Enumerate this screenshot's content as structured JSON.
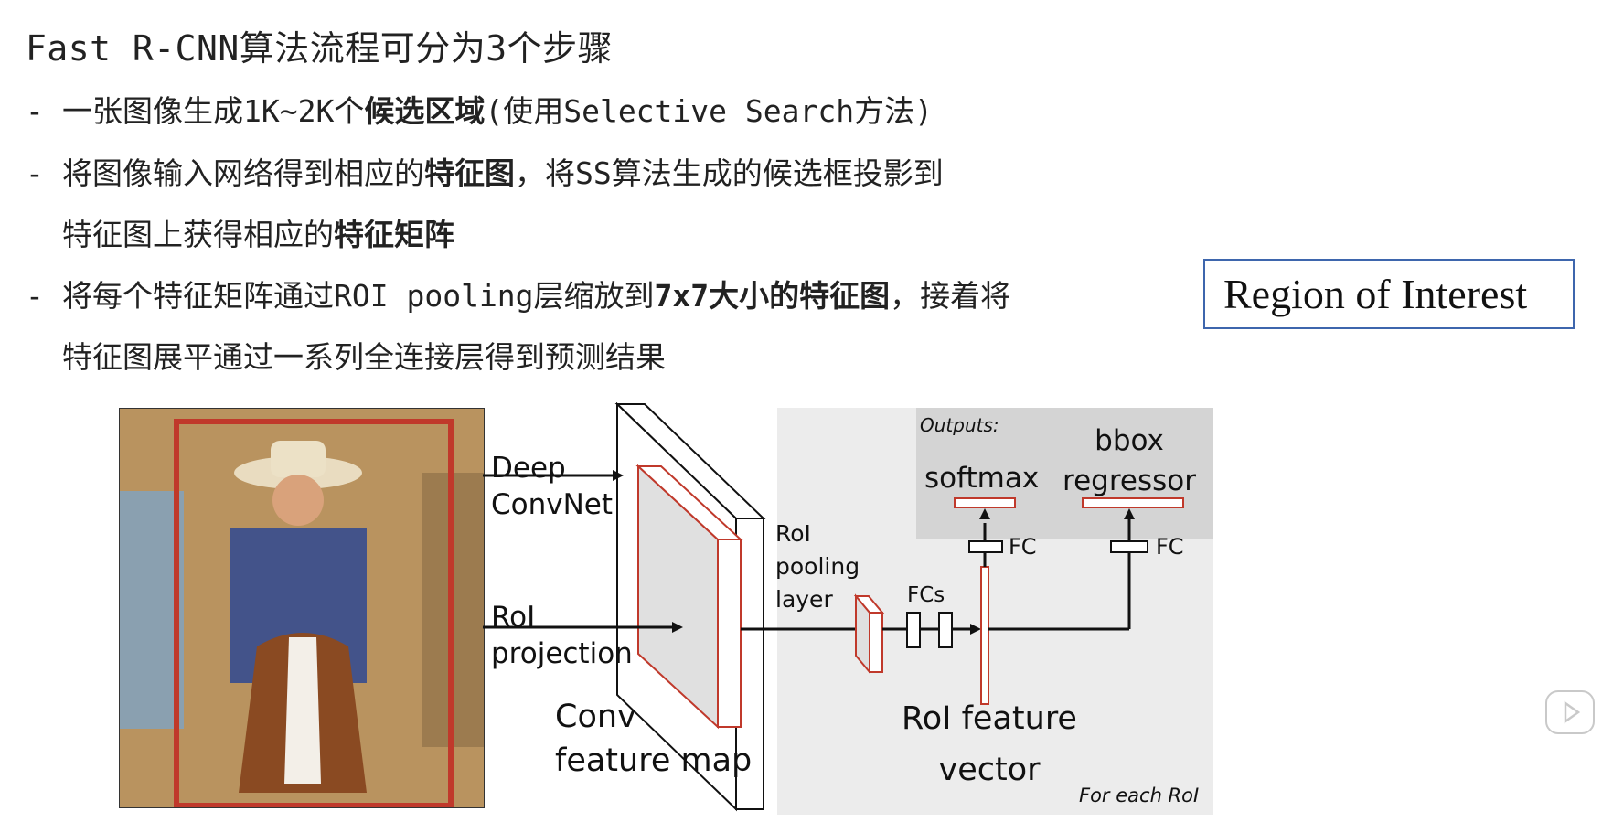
{
  "title": "Fast R-CNN算法流程可分为3个步骤",
  "steps": [
    {
      "dash": "-",
      "plain1": "一张图像生成1K~2K个",
      "bold1": "候选区域",
      "plain2": "(使用Selective Search方法)"
    },
    {
      "dash": "-",
      "plain1": "将图像输入网络得到相应的",
      "bold1": "特征图",
      "plain2": "，将SS算法生成的候选框投影到",
      "cont_plain": "特征图上获得相应的",
      "cont_bold": "特征矩阵"
    },
    {
      "dash": "-",
      "plain1": "将每个特征矩阵通过ROI pooling层缩放到",
      "bold1": "7x7大小的特征图",
      "plain2": "，接着将",
      "cont_plain": "特征图展平通过一系列全连接层得到预测结果"
    }
  ],
  "roi_box": "Region of Interest",
  "diagram": {
    "deep_convnet": [
      "Deep",
      "ConvNet"
    ],
    "roi_projection": [
      "RoI",
      "projection"
    ],
    "conv_feature_map": [
      "Conv",
      "feature map"
    ],
    "roi_pooling_layer": [
      "RoI",
      "pooling",
      "layer"
    ],
    "fcs": "FCs",
    "outputs": "Outputs:",
    "softmax": "softmax",
    "bbox_regressor": [
      "bbox",
      "regressor"
    ],
    "fc_left": "FC",
    "fc_right": "FC",
    "roi_feature_vector": [
      "RoI feature",
      "vector"
    ],
    "for_each_roi": "For each RoI"
  },
  "colors": {
    "accent_red": "#c0392b",
    "roi_border": "#3e66ad"
  },
  "icons": [
    "play-icon"
  ]
}
